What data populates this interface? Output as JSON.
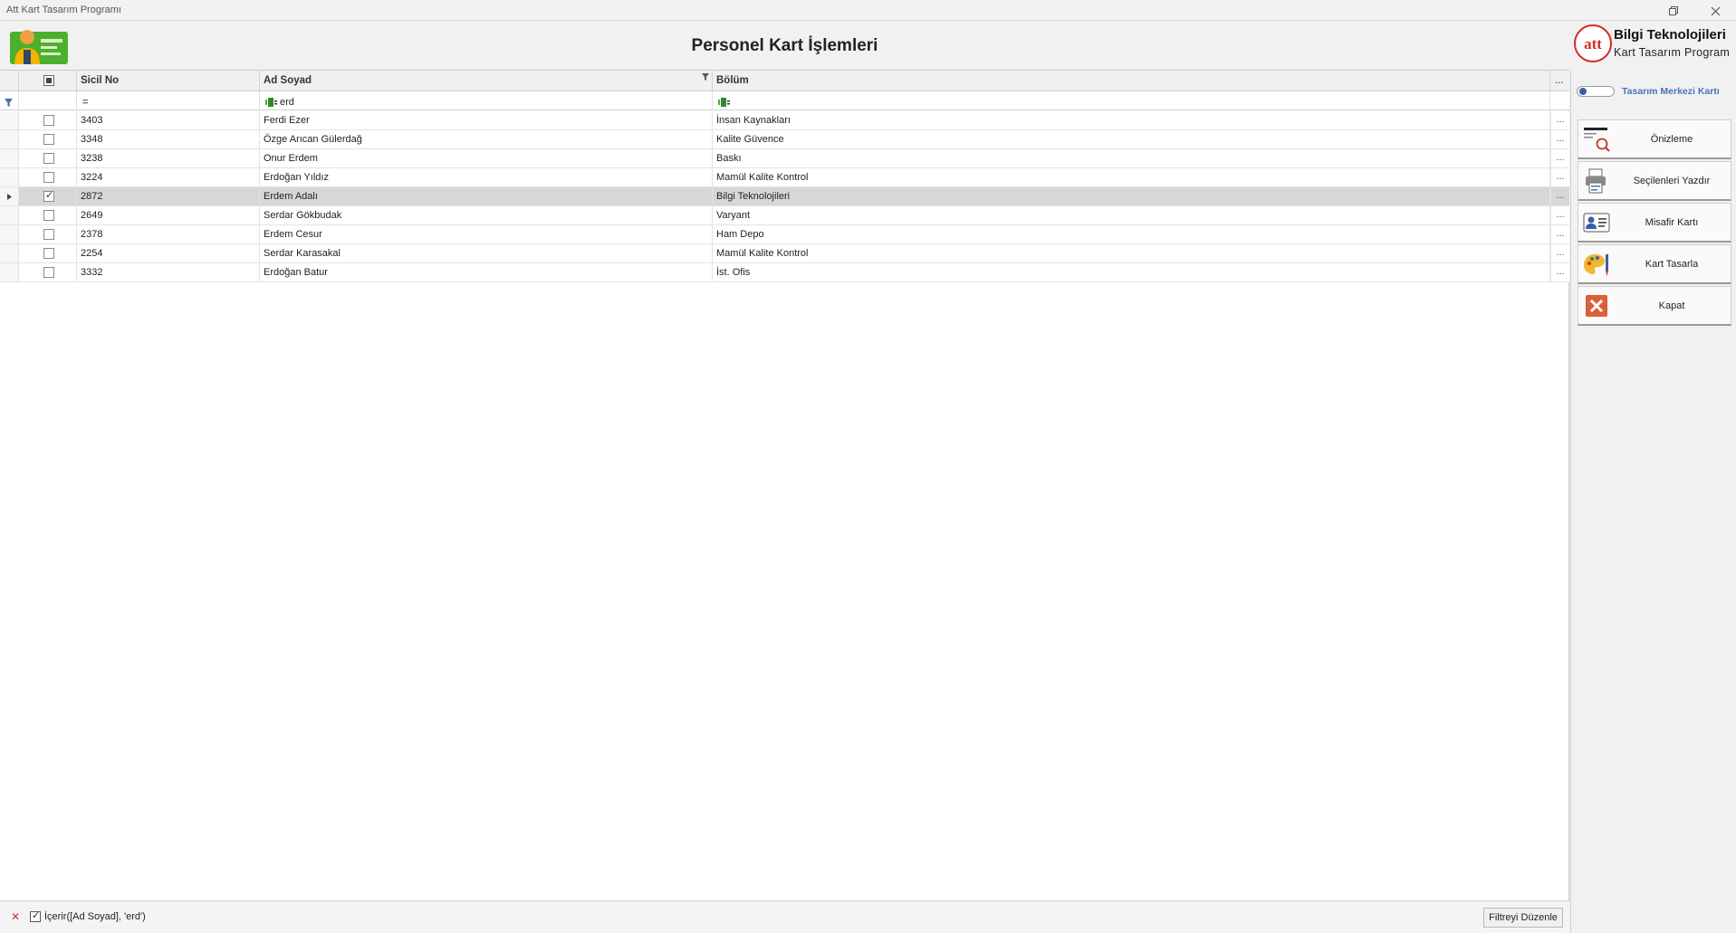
{
  "window": {
    "title": "Att Kart Tasarım Programı"
  },
  "header": {
    "title": "Personel Kart İşlemleri"
  },
  "brand": {
    "line1": "Bilgi Teknolojileri",
    "line2": "Kart Tasarım Program",
    "logo_text": "att",
    "accent": "#d62b2b"
  },
  "grid": {
    "columns": [
      "Sicil No",
      "Ad Soyad",
      "Bölüm"
    ],
    "filter": {
      "sicil": "=",
      "ad_soyad": "erd",
      "bolum": ""
    },
    "rows": [
      {
        "sicil": "3403",
        "ad": "Ferdi Ezer",
        "bolum": "İnsan Kaynakları",
        "checked": false,
        "selected": false
      },
      {
        "sicil": "3348",
        "ad": "Özge Arıcan Gülerdağ",
        "bolum": "Kalite Güvence",
        "checked": false,
        "selected": false
      },
      {
        "sicil": "3238",
        "ad": "Onur Erdem",
        "bolum": "Baskı",
        "checked": false,
        "selected": false
      },
      {
        "sicil": "3224",
        "ad": "Erdoğan Yıldız",
        "bolum": "Mamül Kalite Kontrol",
        "checked": false,
        "selected": false
      },
      {
        "sicil": "2872",
        "ad": "Erdem Adalı",
        "bolum": "Bilgi Teknolojileri",
        "checked": true,
        "selected": true
      },
      {
        "sicil": "2649",
        "ad": "Serdar Gökbudak",
        "bolum": "Varyant",
        "checked": false,
        "selected": false
      },
      {
        "sicil": "2378",
        "ad": "Erdem Cesur",
        "bolum": "Ham Depo",
        "checked": false,
        "selected": false
      },
      {
        "sicil": "2254",
        "ad": "Serdar Karasakal",
        "bolum": "Mamül Kalite Kontrol",
        "checked": false,
        "selected": false
      },
      {
        "sicil": "3332",
        "ad": "Erdoğan Batur",
        "bolum": "İst. Ofis",
        "checked": false,
        "selected": false
      }
    ],
    "ellipsis": "...",
    "active_filter": "İçerir([Ad Soyad], 'erd')",
    "edit_filter_label": "Filtreyi Düzenle"
  },
  "sidebar": {
    "toggle_label": "Tasarım Merkezi Kartı",
    "buttons": [
      {
        "label": "Önizleme",
        "icon": "preview-icon"
      },
      {
        "label": "Seçilenleri Yazdır",
        "icon": "printer-icon"
      },
      {
        "label": "Misafir Kartı",
        "icon": "id-card-icon"
      },
      {
        "label": "Kart Tasarla",
        "icon": "palette-icon"
      },
      {
        "label": "Kapat",
        "icon": "close-icon"
      }
    ]
  }
}
